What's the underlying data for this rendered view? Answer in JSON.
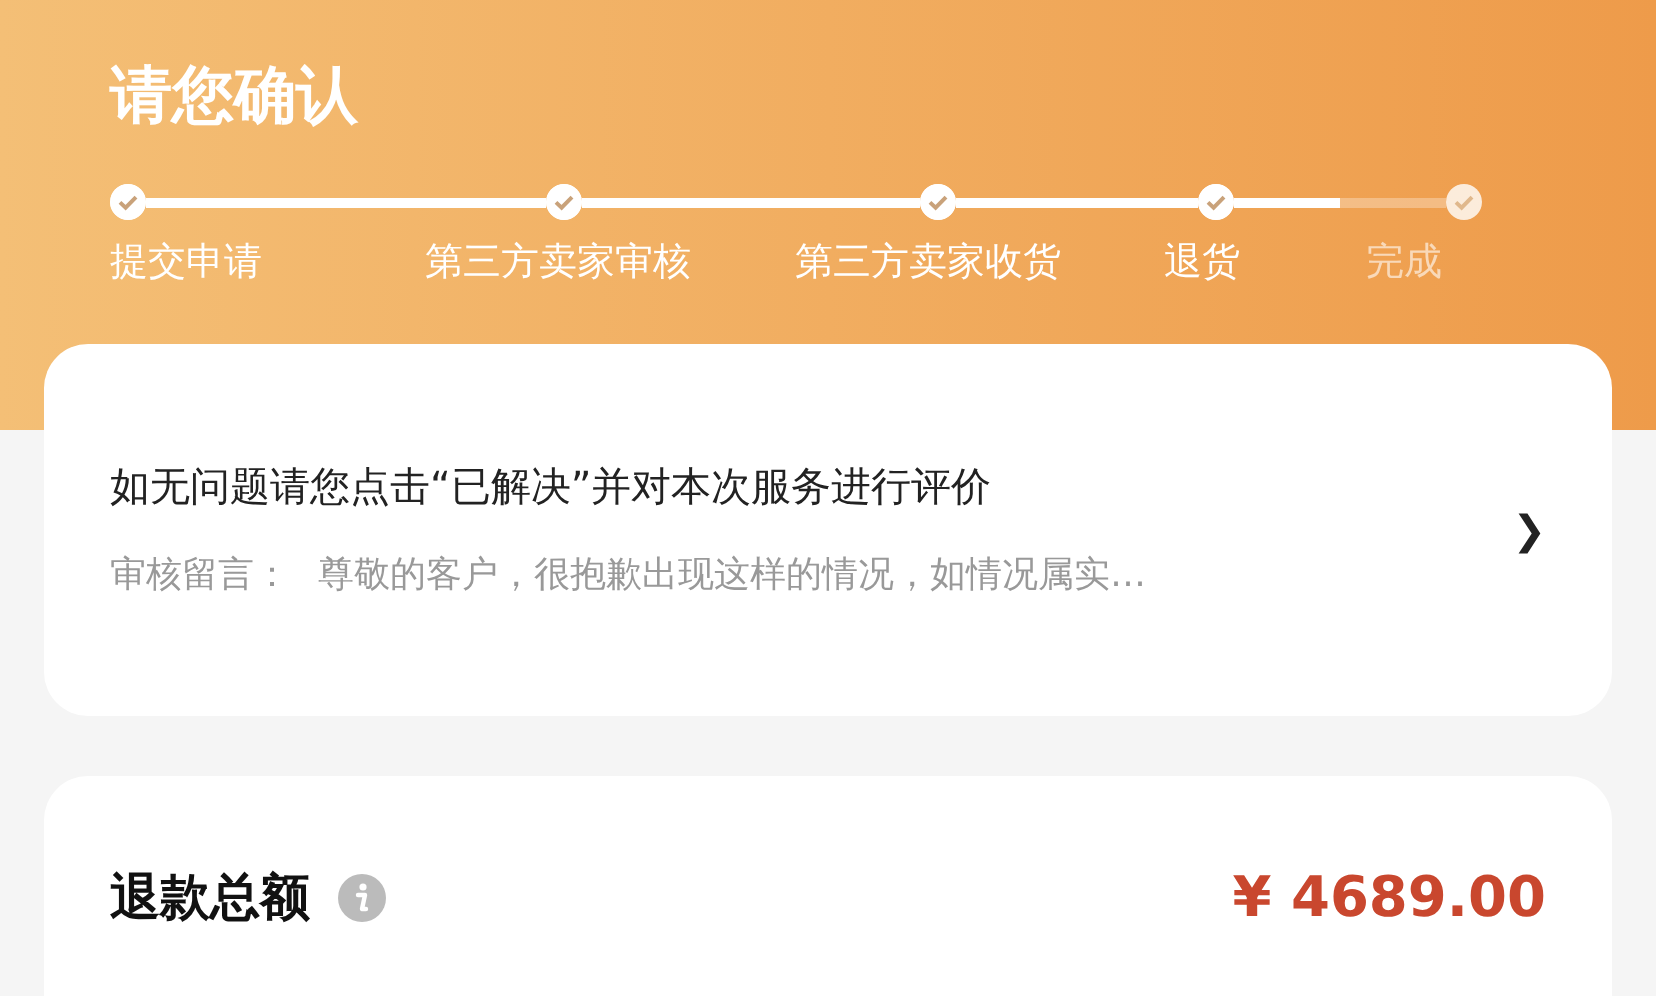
{
  "header": {
    "title": "请您确认"
  },
  "steps": [
    {
      "label": "提交申请",
      "done": true
    },
    {
      "label": "第三方卖家审核",
      "done": true
    },
    {
      "label": "第三方卖家收货",
      "done": true
    },
    {
      "label": "退货",
      "done": true
    },
    {
      "label": "完成",
      "done": false
    }
  ],
  "notice_card": {
    "title": "如无问题请您点击“已解决”并对本次服务进行评价",
    "review_label": "审核留言：",
    "review_text": "尊敬的客户，很抱歉出现这样的情况，如情况属实…",
    "chevron": "❯"
  },
  "refund_card": {
    "label": "退款总额",
    "amount": "¥ 4689.00"
  }
}
